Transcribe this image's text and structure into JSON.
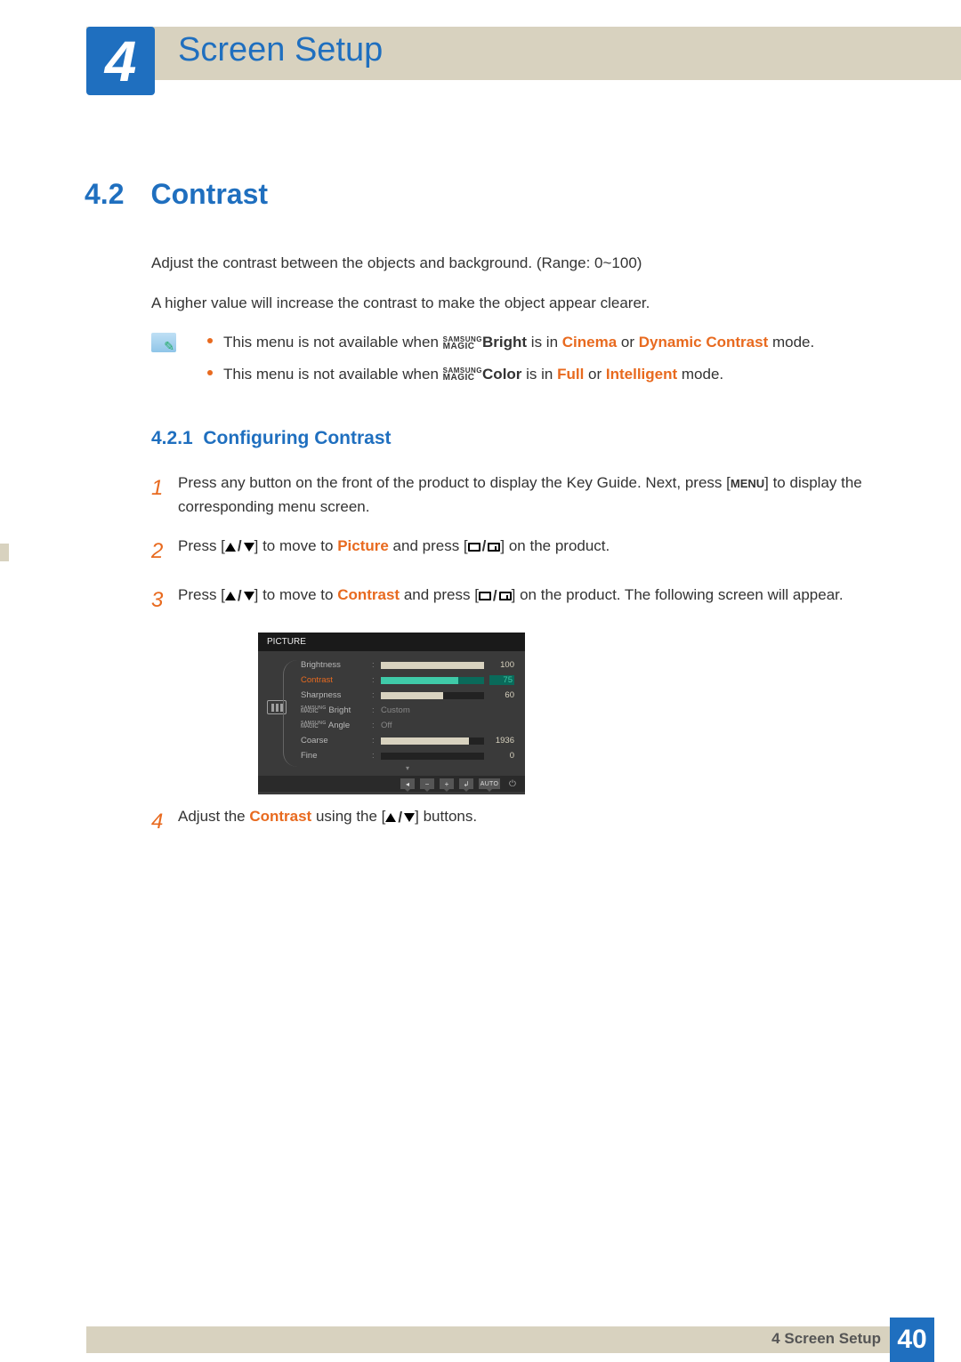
{
  "header": {
    "chapter_num": "4",
    "chapter_title": "Screen Setup"
  },
  "section": {
    "num": "4.2",
    "title": "Contrast"
  },
  "intro": {
    "p1": "Adjust the contrast between the objects and background. (Range: 0~100)",
    "p2": "A higher value will increase the contrast to make the object appear clearer."
  },
  "notes": {
    "n1": {
      "pre": "This menu is not available when ",
      "magic_top": "SAMSUNG",
      "magic_bot": "MAGIC",
      "type": "Bright",
      "mid": " is in ",
      "a": "Cinema",
      "or": " or ",
      "b": "Dynamic Contrast",
      "post": " mode."
    },
    "n2": {
      "pre": "This menu is not available when ",
      "magic_top": "SAMSUNG",
      "magic_bot": "MAGIC",
      "type": "Color",
      "mid": " is in ",
      "a": "Full",
      "or": " or ",
      "b": "Intelligent",
      "post": " mode."
    }
  },
  "subsection": {
    "num": "4.2.1",
    "title": "Configuring Contrast"
  },
  "steps": {
    "s1": {
      "a": "Press any button on the front of the product to display the Key Guide. Next, press [",
      "menu": "MENU",
      "b": "] to display the corresponding menu screen."
    },
    "s2": {
      "a": "Press [",
      "b": "] to move to ",
      "hl": "Picture",
      "c": " and press [",
      "d": "] on the product."
    },
    "s3": {
      "a": "Press [",
      "b": "] to move to ",
      "hl": "Contrast",
      "c": " and press [",
      "d": "] on the product. The following screen will appear."
    },
    "s4": {
      "a": "Adjust the ",
      "hl": "Contrast",
      "b": " using the [",
      "c": "] buttons."
    }
  },
  "osd": {
    "title": "PICTURE",
    "rows": {
      "brightness": {
        "label": "Brightness",
        "val": "100",
        "pct": 100
      },
      "contrast": {
        "label": "Contrast",
        "val": "75",
        "pct": 75
      },
      "sharpness": {
        "label": "Sharpness",
        "val": "60",
        "pct": 60
      },
      "magic_bright_top": "SAMSUNG",
      "magic_bright_bot": "MAGIC",
      "magic_bright_suf": " Bright",
      "magic_bright_val": "Custom",
      "magic_angle_top": "SAMSUNG",
      "magic_angle_bot": "MAGIC",
      "magic_angle_suf": " Angle",
      "magic_angle_val": "Off",
      "coarse": {
        "label": "Coarse",
        "val": "1936",
        "pct": 85
      },
      "fine": {
        "label": "Fine",
        "val": "0",
        "pct": 0
      }
    },
    "auto": "AUTO"
  },
  "footer": {
    "text": "4 Screen Setup",
    "page": "40"
  }
}
